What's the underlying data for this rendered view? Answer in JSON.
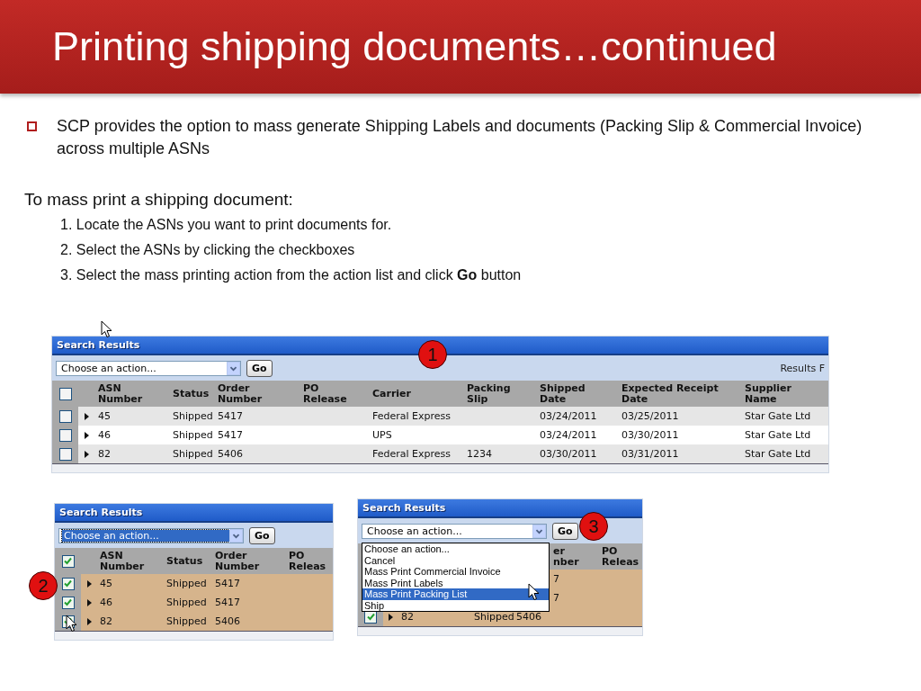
{
  "slide": {
    "title": "Printing shipping documents…continued",
    "bullet": "SCP provides the option to mass generate Shipping Labels and documents (Packing Slip & Commercial Invoice) across multiple ASNs",
    "intro": "To mass print a shipping document:",
    "steps": [
      "1. Locate the ASNs you want to print documents for.",
      "2. Select the ASNs by clicking the checkboxes",
      "3. Select the mass printing action from the action list and click **Go** button"
    ]
  },
  "panels": [
    {
      "title": "Search Results",
      "badge": "1",
      "action": {
        "value": "Choose an action...",
        "highlighted": false
      },
      "go": "Go",
      "results_label": "Results F",
      "all_checked": false,
      "columns": [
        "ASN\nNumber",
        "Status",
        "Order\nNumber",
        "PO\nRelease",
        "Carrier",
        "Packing\nSlip",
        "Shipped\nDate",
        "Expected Receipt\nDate",
        "Supplier\nName"
      ],
      "rows": [
        {
          "kind": "full",
          "checked": false,
          "selected": false,
          "cells": [
            "45",
            "Shipped",
            "5417",
            null,
            "Federal Express",
            null,
            "03/24/2011",
            "03/25/2011",
            "Star Gate Ltd"
          ]
        },
        {
          "kind": "full",
          "checked": false,
          "selected": false,
          "cells": [
            "46",
            "Shipped",
            "5417",
            null,
            "UPS",
            null,
            "03/24/2011",
            "03/30/2011",
            "Star Gate Ltd"
          ]
        },
        {
          "kind": "full",
          "checked": false,
          "selected": false,
          "cells": [
            "82",
            "Shipped",
            "5406",
            null,
            "Federal Express",
            "1234",
            "03/30/2011",
            "03/31/2011",
            "Star Gate Ltd"
          ]
        }
      ]
    },
    {
      "title": "Search Results",
      "badge": "2",
      "action": {
        "value": "Choose an action...",
        "highlighted": true
      },
      "go": "Go",
      "all_checked": true,
      "columns": [
        "ASN\nNumber",
        "Status",
        "Order\nNumber",
        "PO\nReleas"
      ],
      "rows": [
        {
          "kind": "full",
          "checked": true,
          "selected": true,
          "cells": [
            "45",
            "Shipped",
            "5417",
            null
          ]
        },
        {
          "kind": "full",
          "checked": true,
          "selected": true,
          "cells": [
            "46",
            "Shipped",
            "5417",
            null
          ]
        },
        {
          "kind": "full",
          "checked": true,
          "selected": true,
          "cells": [
            "82",
            "Shipped",
            "5406",
            null
          ]
        }
      ]
    },
    {
      "title": "Search Results",
      "badge": "3",
      "action": {
        "value": "Choose an action...",
        "highlighted": false
      },
      "go": "Go",
      "menu": [
        {
          "label": "Choose an action...",
          "selected": false
        },
        {
          "label": "Cancel",
          "selected": false
        },
        {
          "label": "Mass Print Commercial Invoice",
          "selected": false
        },
        {
          "label": "Mass Print Labels",
          "selected": false
        },
        {
          "label": "Mass Print Packing List",
          "selected": true
        },
        {
          "label": "Ship",
          "selected": false
        }
      ],
      "columns": [
        null,
        null,
        "er\nnber",
        "PO\nReleas"
      ],
      "rows": [
        {
          "kind": "covered",
          "selected": true,
          "cells": [
            null,
            null,
            "7",
            null
          ]
        },
        {
          "kind": "covered",
          "selected": true,
          "cells": [
            null,
            null,
            "7",
            null
          ]
        },
        {
          "kind": "full",
          "checked": true,
          "selected": true,
          "cells": [
            "82",
            "Shipped",
            "5406",
            null
          ]
        }
      ]
    }
  ]
}
